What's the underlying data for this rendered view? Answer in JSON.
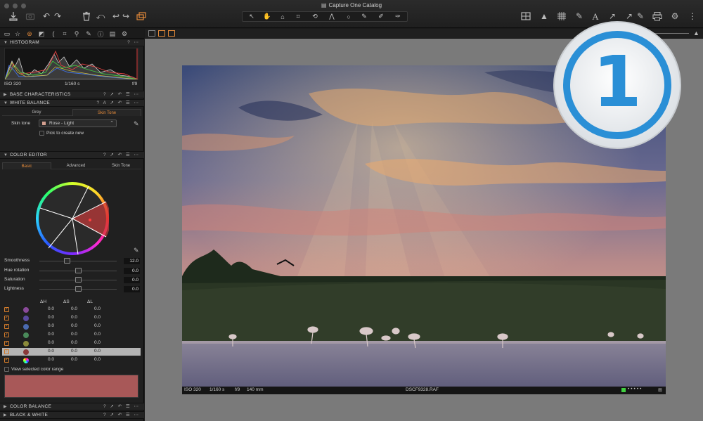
{
  "window": {
    "title": "Capture One Catalog"
  },
  "toolbar": {
    "left_icons": [
      "import-icon",
      "camera-icon",
      "rotate-left-icon",
      "rotate-right-icon",
      "trash-icon",
      "undo-icon",
      "undo-back-icon",
      "redo-icon",
      "stack-icon"
    ],
    "cursor_tools": [
      "select-cursor-icon",
      "pan-hand-icon",
      "loupe-icon",
      "crop-icon",
      "rotate-straighten-icon",
      "keystone-icon",
      "spot-circle-icon",
      "color-picker-icon",
      "brush-icon",
      "eraser-icon"
    ],
    "right_icons": [
      "compare-icon",
      "exposure-warning-icon",
      "grid-icon",
      "color-editor-icon",
      "text-icon",
      "copy-adjustments-icon",
      "apply-adjustments-icon",
      "print-icon",
      "settings-icon"
    ]
  },
  "left_panel": {
    "tool_tab_icons": [
      "library-icon",
      "capture-icon",
      "color-icon",
      "exposure-icon",
      "lens-icon",
      "composition-icon",
      "details-icon",
      "local-adjustments-icon",
      "metadata-icon",
      "output-icon",
      "batch-icon",
      "settings-icon"
    ],
    "histogram": {
      "title": "HISTOGRAM",
      "iso": "ISO 320",
      "shutter": "1/160 s",
      "aperture": "f/9"
    },
    "base_characteristics": {
      "title": "BASE CHARACTERISTICS"
    },
    "white_balance": {
      "title": "WHITE BALANCE",
      "tabs": [
        "Grey",
        "Skin Tone"
      ],
      "active_tab": "Skin Tone",
      "skin_tone_label": "Skin tone",
      "skin_tone_value": "Rose - Light",
      "pick_label": "Pick to create new"
    },
    "color_editor": {
      "title": "COLOR EDITOR",
      "tabs": [
        "Basic",
        "Advanced",
        "Skin Tone"
      ],
      "active_tab": "Basic",
      "sliders": [
        {
          "label": "Smoothness",
          "value": "12.0",
          "pos": 0.35
        },
        {
          "label": "Hue rotation",
          "value": "0.0",
          "pos": 0.5
        },
        {
          "label": "Saturation",
          "value": "0.0",
          "pos": 0.5
        },
        {
          "label": "Lightness",
          "value": "0.0",
          "pos": 0.5
        }
      ],
      "table_headers": [
        "ΔH",
        "ΔS",
        "ΔL"
      ],
      "rows": [
        {
          "color": "#8a4a9a",
          "dh": "0.0",
          "ds": "0.0",
          "dl": "0.0",
          "selected": false
        },
        {
          "color": "#5a4aa0",
          "dh": "0.0",
          "ds": "0.0",
          "dl": "0.0",
          "selected": false
        },
        {
          "color": "#4a6ab0",
          "dh": "0.0",
          "ds": "0.0",
          "dl": "0.0",
          "selected": false
        },
        {
          "color": "#4a8a5a",
          "dh": "0.0",
          "ds": "0.0",
          "dl": "0.0",
          "selected": false
        },
        {
          "color": "#8a8a3a",
          "dh": "0.0",
          "ds": "0.0",
          "dl": "0.0",
          "selected": false
        },
        {
          "color": "#8a3a3a",
          "dh": "0.0",
          "ds": "0.0",
          "dl": "0.0",
          "selected": true
        },
        {
          "color": "rainbow",
          "dh": "0.0",
          "ds": "0.0",
          "dl": "0.0",
          "selected": false
        }
      ],
      "view_range_label": "View selected color range",
      "range_color": "#a85858"
    },
    "color_balance": {
      "title": "COLOR BALANCE"
    },
    "black_white": {
      "title": "BLACK & WHITE"
    }
  },
  "viewer": {
    "status": {
      "iso": "ISO 320",
      "shutter": "1/160 s",
      "aperture": "f/9",
      "focal": "140 mm",
      "filename": "DSCF9328.RAF"
    }
  },
  "colors": {
    "accent": "#e48a3a",
    "logo_blue": "#2a8fd6"
  },
  "logo": {
    "text": "1"
  }
}
